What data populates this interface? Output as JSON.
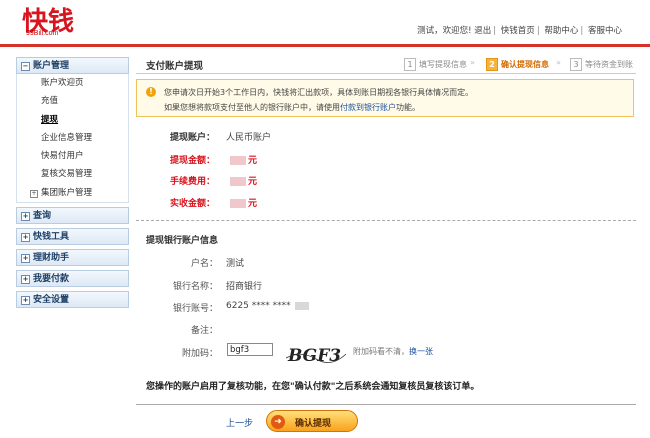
{
  "header": {
    "logo_text": "99Bill.com",
    "nav": [
      "测试，欢迎您!",
      "退出",
      "快钱首页",
      "帮助中心",
      "客服中心"
    ]
  },
  "sidebar": {
    "sections": [
      {
        "label": "账户管理",
        "expanded": true,
        "items": [
          {
            "label": "账户欢迎页"
          },
          {
            "label": "充值"
          },
          {
            "label": "提现",
            "active": true
          },
          {
            "label": "企业信息管理"
          },
          {
            "label": "快易付用户"
          },
          {
            "label": "复核交易管理"
          },
          {
            "label": "集团账户管理",
            "expandable": true
          }
        ]
      },
      {
        "label": "查询"
      },
      {
        "label": "快钱工具"
      },
      {
        "label": "理财助手"
      },
      {
        "label": "我要付款"
      },
      {
        "label": "安全设置"
      }
    ]
  },
  "main": {
    "title": "支付账户提现",
    "steps": [
      {
        "num": "1",
        "label": "填写提现信息"
      },
      {
        "num": "2",
        "label": "确认提现信息",
        "current": true
      },
      {
        "num": "3",
        "label": "等待资金到账"
      }
    ],
    "notice": {
      "line1": "您申请次日开始3个工作日内，快钱将汇出款项，具体到账日期视各银行具体情况而定。",
      "line2_pre": "如果您想将款项支付至他人的银行账户中，请使用",
      "line2_link": "付款到银行账户",
      "line2_post": "功能。"
    },
    "withdraw": {
      "account_label": "提现账户：",
      "account_value": "人民币账户",
      "amount_label": "提现金额：",
      "fee_label": "手续费用：",
      "received_label": "实收金额：",
      "unit": "元"
    },
    "bank": {
      "title": "提现银行账户信息",
      "fields": [
        {
          "k": "户名：",
          "v": "测试"
        },
        {
          "k": "银行名称：",
          "v": "招商银行"
        },
        {
          "k": "银行账号：",
          "v": "6225 **** ****"
        },
        {
          "k": "备注：",
          "v": ""
        }
      ],
      "code_label": "附加码：",
      "code_value": "bgf3",
      "captcha_text": "BGF3",
      "captcha_hint": "附加码看不清，",
      "captcha_change": "换一张"
    },
    "review_notice": "您操作的账户启用了复核功能，在您\"确认付款\"之后系统会通知复核员复核该订单。",
    "prev_label": "上一步",
    "confirm_label": "确认提现"
  },
  "colors": {
    "accent_red": "#d5322a",
    "link_blue": "#1a4fa0",
    "step_orange": "#f8b43a"
  }
}
